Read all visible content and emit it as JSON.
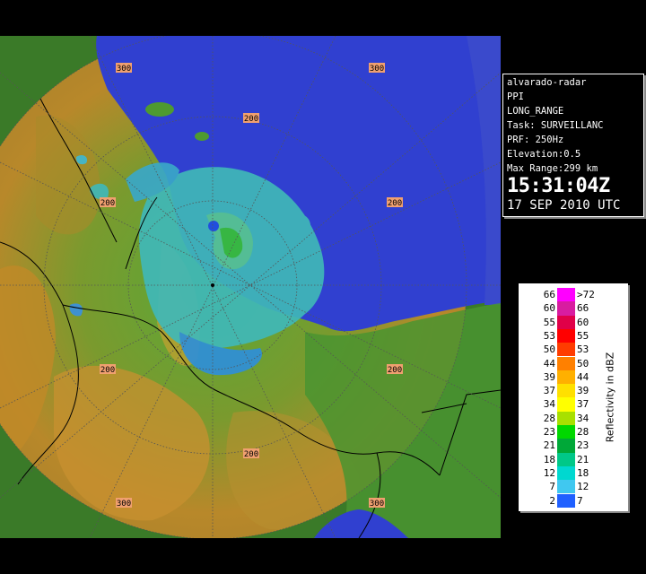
{
  "info": {
    "station": "alvarado-radar",
    "product": "PPI",
    "range_mode": "LONG_RANGE",
    "task": "Task: SURVEILLANC",
    "prf": "PRF: 250Hz",
    "elevation": "Elevation:0.5",
    "max_range": "Max Range:299 km",
    "time": "15:31:04Z",
    "date": "17 SEP 2010 UTC"
  },
  "legend": {
    "title": "Reflectivity in dBZ",
    "rows": [
      {
        "low": "66",
        "high": ">72",
        "color": "#ff00ff"
      },
      {
        "low": "60",
        "high": "66",
        "color": "#d81ca0"
      },
      {
        "low": "55",
        "high": "60",
        "color": "#e00048"
      },
      {
        "low": "53",
        "high": "55",
        "color": "#ff0000"
      },
      {
        "low": "50",
        "high": "53",
        "color": "#ff3c00"
      },
      {
        "low": "44",
        "high": "50",
        "color": "#ff8000"
      },
      {
        "low": "39",
        "high": "44",
        "color": "#ffb000"
      },
      {
        "low": "37",
        "high": "39",
        "color": "#ffe000"
      },
      {
        "low": "34",
        "high": "37",
        "color": "#ffff00"
      },
      {
        "low": "28",
        "high": "34",
        "color": "#a8e000"
      },
      {
        "low": "23",
        "high": "28",
        "color": "#00d800"
      },
      {
        "low": "21",
        "high": "23",
        "color": "#00a838"
      },
      {
        "low": "18",
        "high": "21",
        "color": "#00c888"
      },
      {
        "low": "12",
        "high": "18",
        "color": "#00d8d0"
      },
      {
        "low": "7",
        "high": "12",
        "color": "#40c8f0"
      },
      {
        "low": "2",
        "high": "7",
        "color": "#2060ff"
      }
    ]
  },
  "range_labels": [
    "300",
    "300",
    "200",
    "200",
    "200",
    "200",
    "200",
    "200",
    "300",
    "300"
  ],
  "colors": {
    "ocean": "#3040d0",
    "coastal_plain": "#4e9a30",
    "highland": "#b88a2a",
    "radar_echo": "#40b8b8"
  }
}
